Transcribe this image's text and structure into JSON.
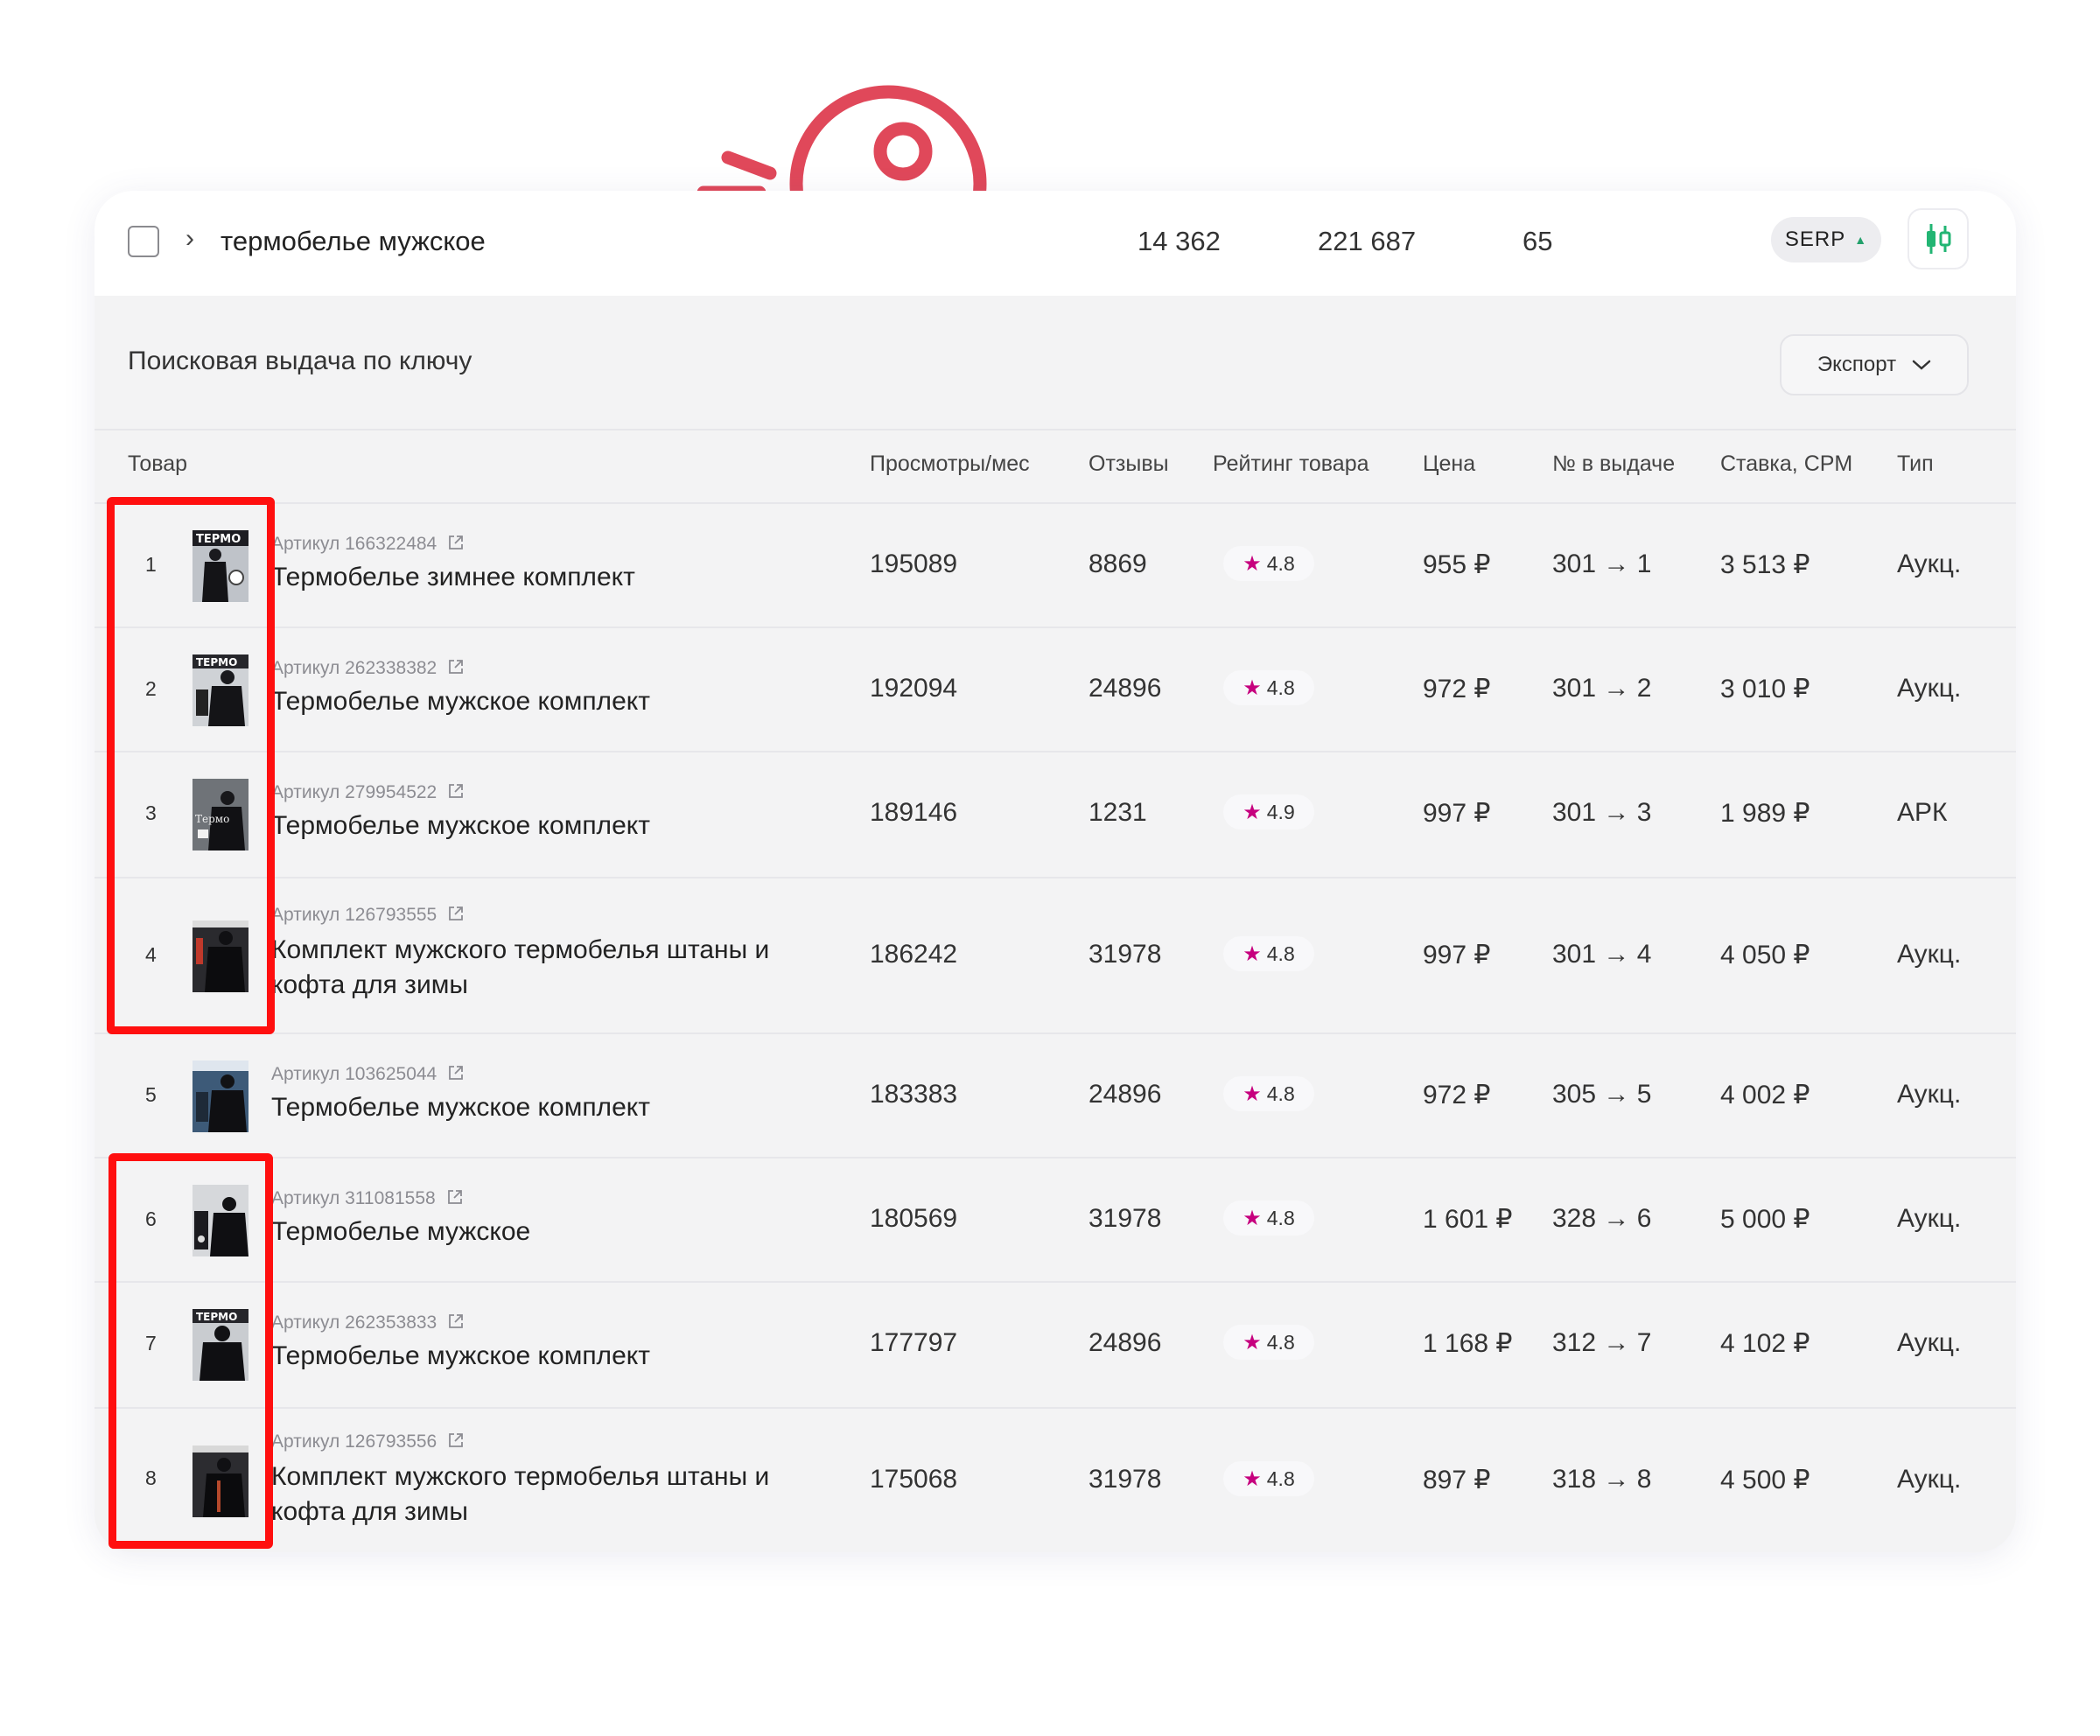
{
  "keyword_row": {
    "keyword": "термобелье мужское",
    "stats": [
      "14 362",
      "221 687",
      "65"
    ],
    "serp_label": "SERP",
    "serp_arrow": "▲"
  },
  "section": {
    "title": "Поисковая выдача по ключу",
    "export_label": "Экспорт"
  },
  "columns": {
    "product": "Товар",
    "views": "Просмотры/мес",
    "reviews": "Отзывы",
    "rating": "Рейтинг товара",
    "price": "Цена",
    "position": "№ в выдаче",
    "bid": "Ставка, CPM",
    "type": "Тип"
  },
  "rows": [
    {
      "rank": "1",
      "sku": "Артикул 166322484",
      "name": "Термобелье зимнее комплект",
      "views": "195089",
      "reviews": "8869",
      "rating": "4.8",
      "price": "955 ₽",
      "position": "301 → 1",
      "bid": "3 513 ₽",
      "type": "Аукц."
    },
    {
      "rank": "2",
      "sku": "Артикул 262338382",
      "name": "Термобелье мужское комплект",
      "views": "192094",
      "reviews": "24896",
      "rating": "4.8",
      "price": "972 ₽",
      "position": "301 → 2",
      "bid": "3 010 ₽",
      "type": "Аукц."
    },
    {
      "rank": "3",
      "sku": "Артикул 279954522",
      "name": "Термобелье мужское комплект",
      "views": "189146",
      "reviews": "1231",
      "rating": "4.9",
      "price": "997 ₽",
      "position": "301 → 3",
      "bid": "1 989 ₽",
      "type": "АРК"
    },
    {
      "rank": "4",
      "sku": "Артикул 126793555",
      "name": "Комплект мужского термобелья штаны и кофта для зимы",
      "views": "186242",
      "reviews": "31978",
      "rating": "4.8",
      "price": "997 ₽",
      "position": "301 → 4",
      "bid": "4 050 ₽",
      "type": "Аукц."
    },
    {
      "rank": "5",
      "sku": "Артикул 103625044",
      "name": "Термобелье мужское комплект",
      "views": "183383",
      "reviews": "24896",
      "rating": "4.8",
      "price": "972 ₽",
      "position": "305 → 5",
      "bid": "4 002 ₽",
      "type": "Аукц."
    },
    {
      "rank": "6",
      "sku": "Артикул 311081558",
      "name": "Термобелье мужское",
      "views": "180569",
      "reviews": "31978",
      "rating": "4.8",
      "price": "1 601 ₽",
      "position": "328 → 6",
      "bid": "5 000 ₽",
      "type": "Аукц."
    },
    {
      "rank": "7",
      "sku": "Артикул 262353833",
      "name": "Термобелье мужское комплект",
      "views": "177797",
      "reviews": "24896",
      "rating": "4.8",
      "price": "1 168 ₽",
      "position": "312 → 7",
      "bid": "4 102 ₽",
      "type": "Аукц."
    },
    {
      "rank": "8",
      "sku": "Артикул 126793556",
      "name": "Комплект мужского термобелья штаны и кофта для зимы",
      "views": "175068",
      "reviews": "31978",
      "rating": "4.8",
      "price": "897 ₽",
      "position": "318 → 8",
      "bid": "4 500 ₽",
      "type": "Аукц."
    }
  ],
  "thumb_labels": {
    "row1": "ТЕРМО",
    "row2": "ТЕРМО",
    "row3": "Термо",
    "row7": "ТЕРМО"
  },
  "colors": {
    "accent_red": "#ff0f0f",
    "key_illustration": "#e0485a",
    "star": "#c6007e",
    "chart_icon": "#22b573"
  }
}
